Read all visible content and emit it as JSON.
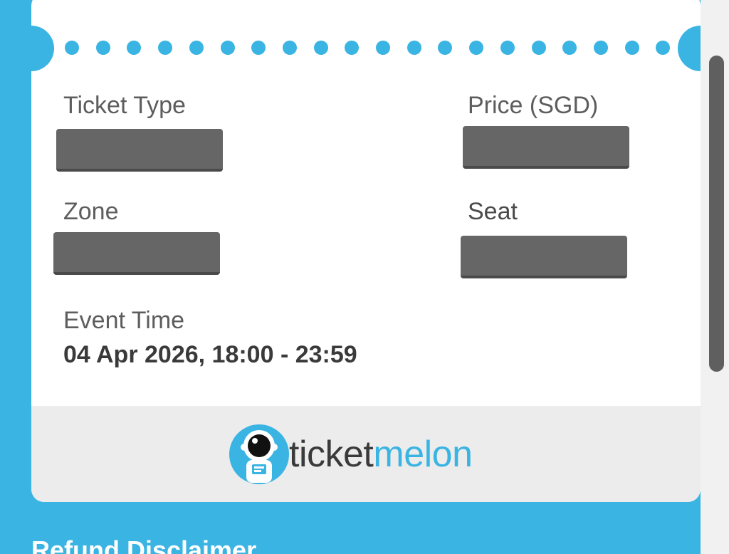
{
  "ticket": {
    "ticket_type_label": "Ticket Type",
    "price_label": "Price (SGD)",
    "zone_label": "Zone",
    "seat_label": "Seat",
    "event_time_label": "Event Time",
    "event_time_value": "04 Apr 2026, 18:00 - 23:59"
  },
  "brand": {
    "name_part1": "ticket",
    "name_part2": "melon",
    "logo_icon": "astronaut-icon"
  },
  "section": {
    "refund_title": "Refund Disclaimer"
  },
  "colors": {
    "accent": "#3ab4e2",
    "redaction": "#666666",
    "footer_bg": "#ececec"
  }
}
